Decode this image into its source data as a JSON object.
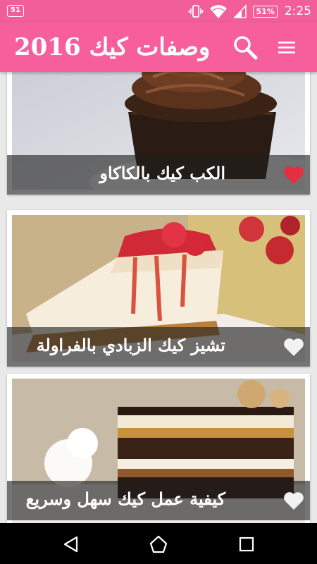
{
  "status_bar": {
    "notification": "51",
    "battery": "51%",
    "time": "2:25"
  },
  "app_bar": {
    "title": "وصفات كيك 2016",
    "search_icon": "search-icon",
    "menu_icon": "hamburger-menu-icon"
  },
  "recipes": [
    {
      "title": "الكب كيك بالكاكاو",
      "favorite": true
    },
    {
      "title": "تشيز كيك الزبادي بالفراولة",
      "favorite": false
    },
    {
      "title": "كيفية عمل كيك سهل وسريع",
      "favorite": false
    }
  ],
  "nav_bar": {
    "back_icon": "back-icon",
    "home_icon": "home-icon",
    "recents_icon": "recents-icon"
  },
  "colors": {
    "primary": "#f65f9b",
    "status_bar": "#f25e98",
    "favorite_heart": "#e62d41",
    "inactive_heart": "#f2f2f2"
  }
}
